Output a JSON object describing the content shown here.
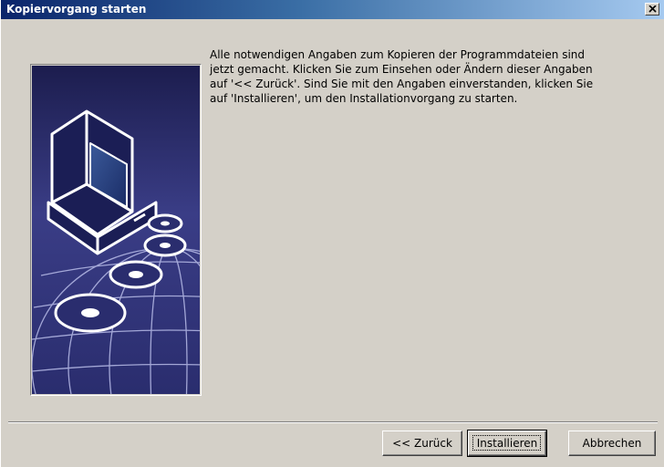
{
  "window": {
    "title": "Kopiervorgang starten"
  },
  "description": "Alle notwendigen Angaben zum Kopieren der Programmdateien sind\njetzt gemacht. Klicken Sie zum Einsehen oder Ändern dieser Angaben\nauf '<< Zurück'. Sind Sie mit den Angaben einverstanden, klicken Sie\nauf 'Installieren', um den Installationvorgang zu starten.",
  "buttons": {
    "back_label": "<< Zurück",
    "install_label": "Installieren",
    "cancel_label": "Abbrechen"
  },
  "icons": {
    "close": "close-icon",
    "illustration": "computer-cd-globe-illustration"
  },
  "colors": {
    "titlebar_start": "#0a246a",
    "titlebar_end": "#a6caf0",
    "dialog_bg": "#d4d0c8",
    "illustration_bg": "#2a2d6e"
  }
}
